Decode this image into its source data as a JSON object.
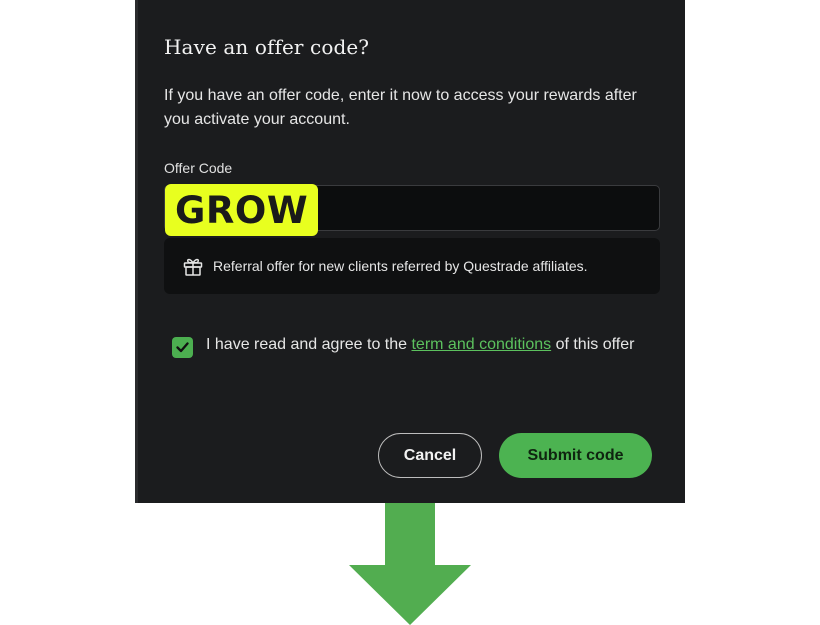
{
  "dialog": {
    "title": "Have an offer code?",
    "description": "If you have an offer code, enter it now to access your rewards after you activate your account.",
    "offer_code_label": "Offer Code",
    "offer_code_value": "GROW",
    "referral_note": "Referral offer for new clients referred by Questrade affiliates.",
    "agreement": {
      "checked": true,
      "text_before": "I have read and agree to the ",
      "link_text": "term and conditions",
      "text_after": " of this offer"
    },
    "cancel_label": "Cancel",
    "submit_label": "Submit code"
  },
  "icons": {
    "gift": "gift-icon",
    "check": "checkmark-icon",
    "arrow": "arrow-down-icon"
  },
  "colors": {
    "dialog_bg": "#1b1c1e",
    "accent_green": "#4cb351",
    "link_green": "#5cc15e",
    "highlight_yellow": "#e8ff1f",
    "arrow_green": "#52ad50"
  }
}
